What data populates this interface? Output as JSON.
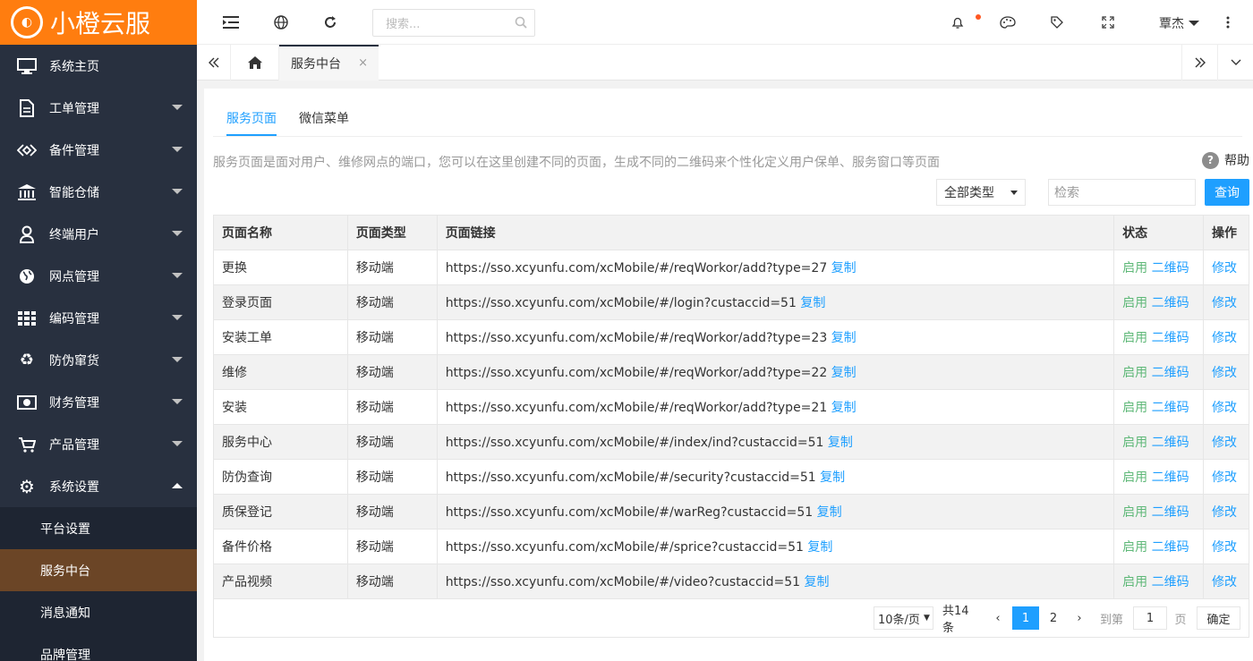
{
  "brand": {
    "name": "小橙云服",
    "logo_mark": "◐"
  },
  "sidebar": {
    "items": [
      {
        "label": "系统主页",
        "icon": "monitor-icon"
      },
      {
        "label": "工单管理",
        "icon": "document-icon"
      },
      {
        "label": "备件管理",
        "icon": "diamond-icon"
      },
      {
        "label": "智能仓储",
        "icon": "bank-icon"
      },
      {
        "label": "终端用户",
        "icon": "user-icon"
      },
      {
        "label": "网点管理",
        "icon": "globe-icon"
      },
      {
        "label": "编码管理",
        "icon": "grid-icon"
      },
      {
        "label": "防伪窜货",
        "icon": "recycle-icon"
      },
      {
        "label": "财务管理",
        "icon": "money-icon"
      },
      {
        "label": "产品管理",
        "icon": "cart-icon"
      },
      {
        "label": "系统设置",
        "icon": "gear-icon"
      }
    ],
    "subitems": [
      "平台设置",
      "服务中台",
      "消息通知",
      "品牌管理"
    ]
  },
  "header": {
    "search_placeholder": "搜索...",
    "user": "覃杰"
  },
  "tabs": {
    "active": "服务中台",
    "close": "×"
  },
  "content": {
    "tabs": [
      "服务页面",
      "微信菜单"
    ],
    "description": "服务页面是面对用户、维修网点的端口，您可以在这里创建不同的页面，生成不同的二维码来个性化定义用户保单、服务窗口等页面",
    "help": "帮助",
    "help_q": "?",
    "type_select": "全部类型",
    "search_placeholder": "检索",
    "query_button": "查询"
  },
  "table": {
    "headers": [
      "页面名称",
      "页面类型",
      "页面链接",
      "状态",
      "操作"
    ],
    "copy": "复制",
    "status": "启用",
    "qrcode": "二维码",
    "edit": "修改",
    "rows": [
      {
        "name": "更换",
        "type": "移动端",
        "url": "https://sso.xcyunfu.com/xcMobile/#/reqWorkor/add?type=27"
      },
      {
        "name": "登录页面",
        "type": "移动端",
        "url": "https://sso.xcyunfu.com/xcMobile/#/login?custaccid=51"
      },
      {
        "name": "安装工单",
        "type": "移动端",
        "url": "https://sso.xcyunfu.com/xcMobile/#/reqWorkor/add?type=23"
      },
      {
        "name": "维修",
        "type": "移动端",
        "url": "https://sso.xcyunfu.com/xcMobile/#/reqWorkor/add?type=22"
      },
      {
        "name": "安装",
        "type": "移动端",
        "url": "https://sso.xcyunfu.com/xcMobile/#/reqWorkor/add?type=21"
      },
      {
        "name": "服务中心",
        "type": "移动端",
        "url": "https://sso.xcyunfu.com/xcMobile/#/index/ind?custaccid=51"
      },
      {
        "name": "防伪查询",
        "type": "移动端",
        "url": "https://sso.xcyunfu.com/xcMobile/#/security?custaccid=51"
      },
      {
        "name": "质保登记",
        "type": "移动端",
        "url": "https://sso.xcyunfu.com/xcMobile/#/warReg?custaccid=51"
      },
      {
        "name": "备件价格",
        "type": "移动端",
        "url": "https://sso.xcyunfu.com/xcMobile/#/sprice?custaccid=51"
      },
      {
        "name": "产品视频",
        "type": "移动端",
        "url": "https://sso.xcyunfu.com/xcMobile/#/video?custaccid=51"
      }
    ]
  },
  "pager": {
    "page_size": "10条/页",
    "total": "共14条",
    "pages": [
      "1",
      "2"
    ],
    "goto": "到第",
    "goto_value": "1",
    "page_unit": "页",
    "confirm": "确定"
  }
}
